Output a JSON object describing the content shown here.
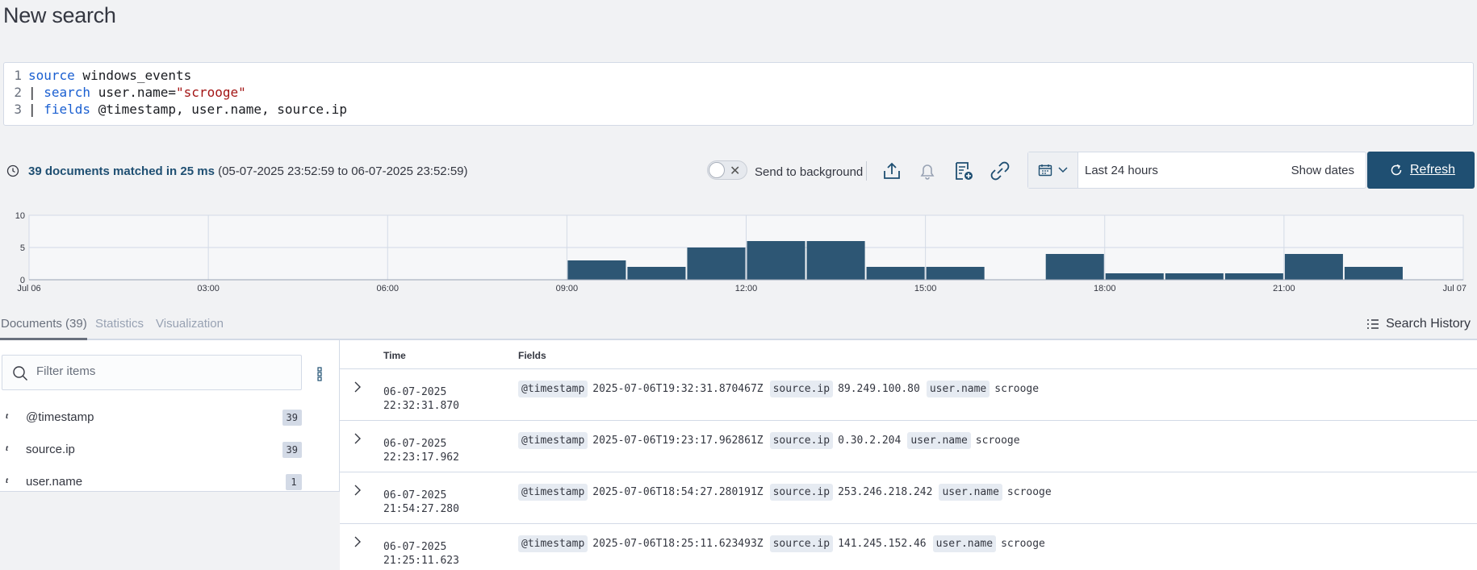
{
  "page_title": "New search",
  "query_lines": [
    {
      "no": "1",
      "parts": [
        {
          "t": "source",
          "k": "kw"
        },
        {
          "t": " windows_events",
          "k": "plain"
        }
      ]
    },
    {
      "no": "2",
      "parts": [
        {
          "t": "| ",
          "k": "pipe"
        },
        {
          "t": "search",
          "k": "kw"
        },
        {
          "t": " user.name=",
          "k": "plain"
        },
        {
          "t": "\"scrooge\"",
          "k": "str"
        }
      ]
    },
    {
      "no": "3",
      "parts": [
        {
          "t": "| ",
          "k": "pipe"
        },
        {
          "t": "fields",
          "k": "kw"
        },
        {
          "t": " @timestamp, user.name, source.ip",
          "k": "plain"
        }
      ]
    }
  ],
  "toolbar": {
    "match_summary": "39 documents matched in 25 ms",
    "match_range": " (05-07-2025 23:52:59 to 06-07-2025 23:52:59)",
    "send_to_background": "Send to background",
    "toggle_x": "✕",
    "time_range": "Last 24 hours",
    "show_dates": "Show dates",
    "refresh": "Refresh"
  },
  "chart_data": {
    "type": "bar",
    "y_ticks": [
      "10",
      "5",
      "0"
    ],
    "ylim": [
      0,
      10
    ],
    "x_ticks": [
      "Jul 06",
      "03:00",
      "06:00",
      "09:00",
      "12:00",
      "15:00",
      "18:00",
      "21:00",
      "Jul 07"
    ],
    "bins_start_hour": 9,
    "bin_hours": 1,
    "values": [
      3,
      2,
      5,
      6,
      6,
      2,
      2,
      0,
      4,
      1,
      1,
      1,
      4,
      2
    ],
    "bar_color": "#2d5674",
    "grid": true
  },
  "tabs": [
    {
      "label": "Documents (39)",
      "active": true
    },
    {
      "label": "Statistics",
      "active": false
    },
    {
      "label": "Visualization",
      "active": false
    }
  ],
  "search_history": "Search History",
  "filter": {
    "placeholder": "Filter items"
  },
  "fields_list": [
    {
      "type": "t",
      "name": "@timestamp",
      "count": "39"
    },
    {
      "type": "t",
      "name": "source.ip",
      "count": "39"
    },
    {
      "type": "t",
      "name": "user.name",
      "count": "1"
    }
  ],
  "table": {
    "headers": {
      "time": "Time",
      "fields": "Fields"
    },
    "rows": [
      {
        "date": "06-07-2025",
        "time": "22:32:31.870",
        "ts": "2025-07-06T19:32:31.870467Z",
        "ip": "89.249.100.80",
        "user": "scrooge"
      },
      {
        "date": "06-07-2025",
        "time": "22:23:17.962",
        "ts": "2025-07-06T19:23:17.962861Z",
        "ip": "0.30.2.204",
        "user": "scrooge"
      },
      {
        "date": "06-07-2025",
        "time": "21:54:27.280",
        "ts": "2025-07-06T18:54:27.280191Z",
        "ip": "253.246.218.242",
        "user": "scrooge"
      },
      {
        "date": "06-07-2025",
        "time": "21:25:11.623",
        "ts": "2025-07-06T18:25:11.623493Z",
        "ip": "141.245.152.46",
        "user": "scrooge"
      }
    ],
    "keys": {
      "ts": "@timestamp",
      "ip": "source.ip",
      "user": "user.name"
    }
  }
}
